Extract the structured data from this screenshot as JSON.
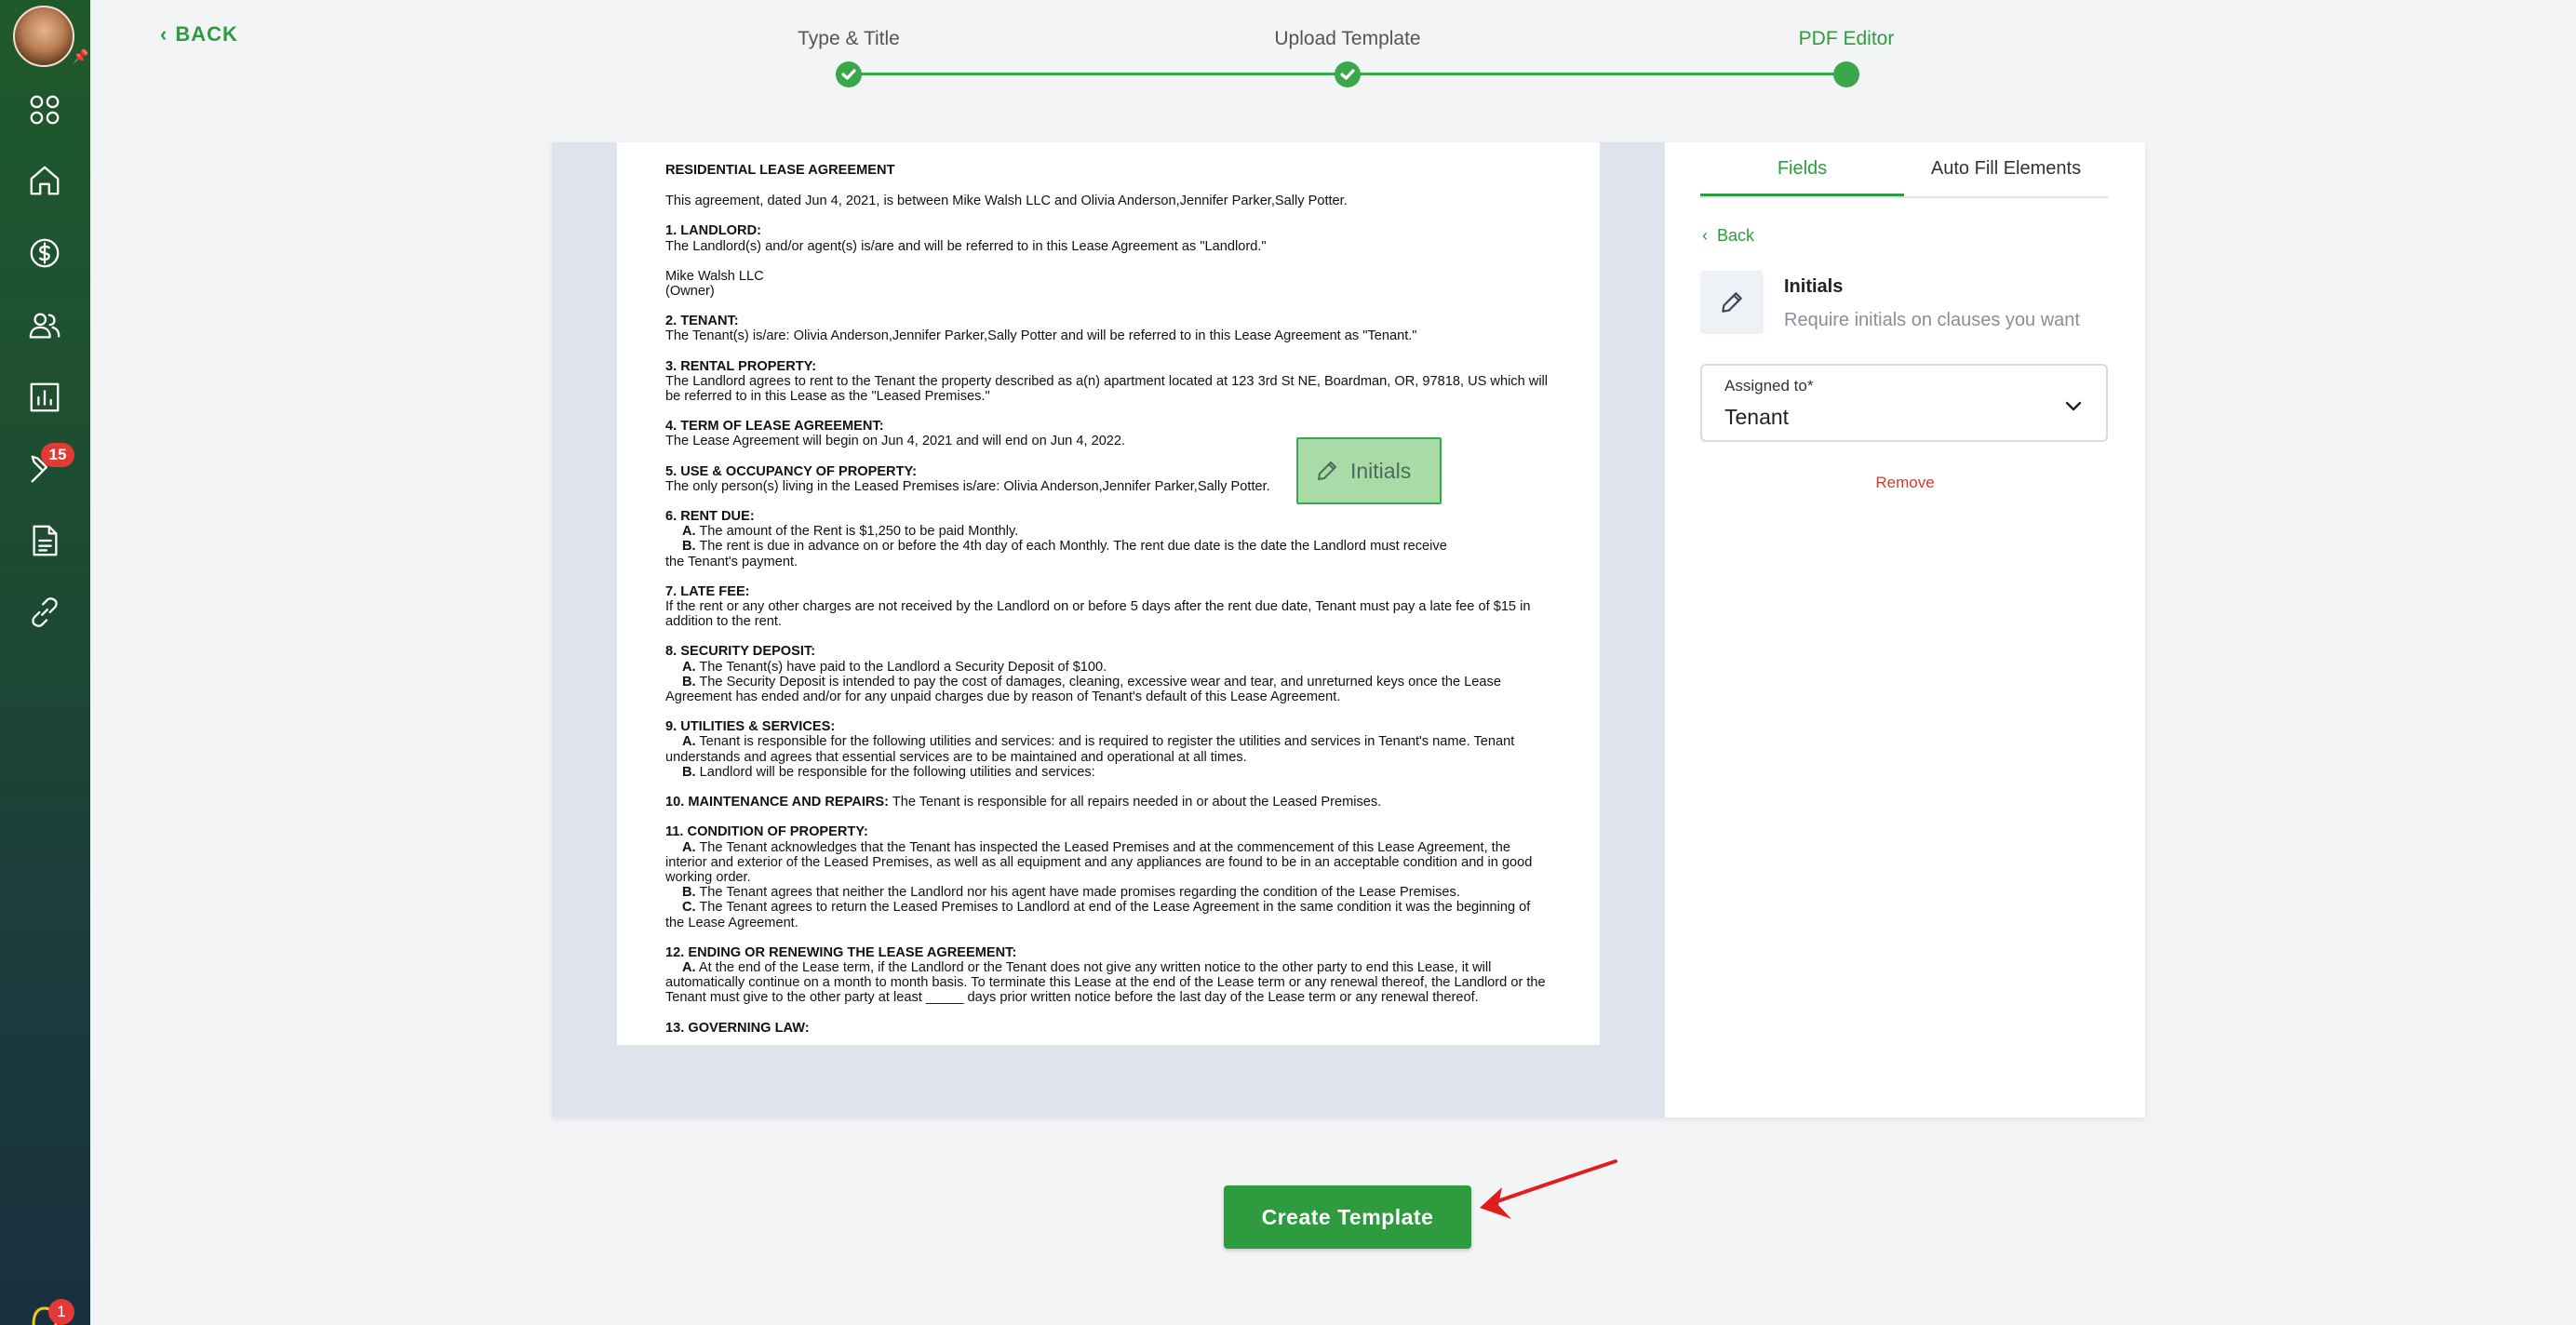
{
  "nav": {
    "badge_count": "15",
    "notification_count": "1"
  },
  "back_label": "BACK",
  "stepper": {
    "steps": [
      {
        "label": "Type & Title",
        "status": "done"
      },
      {
        "label": "Upload Template",
        "status": "done"
      },
      {
        "label": "PDF Editor",
        "status": "active"
      }
    ]
  },
  "document": {
    "title": "RESIDENTIAL LEASE AGREEMENT",
    "intro": "This agreement, dated Jun 4, 2021, is between Mike Walsh LLC and Olivia Anderson,Jennifer Parker,Sally Potter.",
    "s1_h": "1. LANDLORD:",
    "s1_t": "The Landlord(s) and/or agent(s) is/are and will be referred to in this Lease Agreement as \"Landlord.\"",
    "s1_name": "Mike Walsh LLC",
    "s1_role": "(Owner)",
    "s2_h": "2. TENANT:",
    "s2_t": "The Tenant(s) is/are: Olivia Anderson,Jennifer Parker,Sally Potter and will be referred to in this Lease Agreement as \"Tenant.\"",
    "s3_h": "3. RENTAL PROPERTY:",
    "s3_t": "The Landlord agrees to rent to the Tenant the property described as a(n) apartment located at 123 3rd St NE, Boardman, OR, 97818, US which will be referred to in this Lease as the \"Leased Premises.\"",
    "s4_h": "4. TERM OF LEASE AGREEMENT:",
    "s4_t": "The Lease Agreement will begin on Jun 4, 2021 and will end on Jun 4, 2022.",
    "s5_h": "5. USE & OCCUPANCY OF PROPERTY:",
    "s5_t": "The only person(s) living in the Leased Premises is/are: Olivia Anderson,Jennifer Parker,Sally Potter.",
    "s6_h": "6. RENT DUE:",
    "s6_a": "The amount of the Rent is $1,250 to be paid Monthly.",
    "s6_b1": "The rent is due in advance on or before the 4th day of each Monthly. The rent due date is the date the Landlord must receive",
    "s6_b2": "the Tenant's payment.",
    "s7_h": "7. LATE FEE:",
    "s7_t": "If the rent or any other charges are not received by the Landlord on or before 5 days after the rent due date, Tenant must pay a late fee of  $15 in addition to the rent.",
    "s8_h": "8. SECURITY DEPOSIT:",
    "s8_a": "The Tenant(s) have paid to the Landlord a Security Deposit of $100.",
    "s8_b1": "The Security Deposit is intended to pay the cost of damages, cleaning, excessive wear and tear, and unreturned keys once the Lease",
    "s8_b2": "Agreement has ended and/or for any unpaid charges due by reason of Tenant's default of this Lease Agreement.",
    "s9_h": "9. UTILITIES & SERVICES:",
    "s9_a1": "Tenant is responsible for the following utilities and services:  and is required to register the utilities and services in Tenant's name. Tenant",
    "s9_a2": "understands and agrees that essential services are to be maintained and operational at all times.",
    "s9_b": "Landlord will be responsible for the following utilities and services:",
    "s10_h": "10. MAINTENANCE AND REPAIRS:",
    "s10_t": "The Tenant is responsible for all repairs needed in or about the Leased Premises.",
    "s11_h": "11. CONDITION OF PROPERTY:",
    "s11_a1": "The Tenant acknowledges that the Tenant has inspected the Leased Premises and at the commencement of this Lease Agreement, the",
    "s11_a2": "interior and exterior of the Leased Premises, as well as all equipment and any appliances are found to be in an acceptable condition and in good working order.",
    "s11_b": "The Tenant agrees that neither the Landlord nor his agent have made promises regarding the condition of the Lease Premises.",
    "s11_c1": "The Tenant agrees to return the Leased Premises to Landlord at end of the Lease Agreement in the same condition it was the beginning of",
    "s11_c2": "the Lease Agreement.",
    "s12_h": "12. ENDING OR RENEWING THE LEASE AGREEMENT:",
    "s12_a1": "At the end of the Lease term, if the Landlord or the Tenant does not give any written notice to the other party to end this Lease, it will",
    "s12_a2": "automatically continue on a month to month basis. To terminate this Lease at the end of the Lease term or any renewal thereof, the Landlord or the Tenant must give to the other party at least _____ days prior written notice before the last day of the Lease term or any renewal thereof.",
    "s13_h": "13. GOVERNING LAW:",
    "letters": {
      "a": "A.",
      "b": "B.",
      "c": "C."
    }
  },
  "initials_field": {
    "label": "Initials"
  },
  "panel": {
    "tabs": [
      {
        "label": "Fields",
        "active": true
      },
      {
        "label": "Auto Fill Elements",
        "active": false
      }
    ],
    "back_label": "Back",
    "field_title": "Initials",
    "field_desc": "Require initials on clauses you want",
    "assigned_label": "Assigned to*",
    "assigned_value": "Tenant",
    "remove_label": "Remove"
  },
  "create_button": "Create Template",
  "colors": {
    "accent": "#2e9b3e",
    "danger": "#d9362b",
    "sidebar_top": "#1f5a2c",
    "sidebar_bottom": "#19303f",
    "arrow": "#e01e1e"
  }
}
